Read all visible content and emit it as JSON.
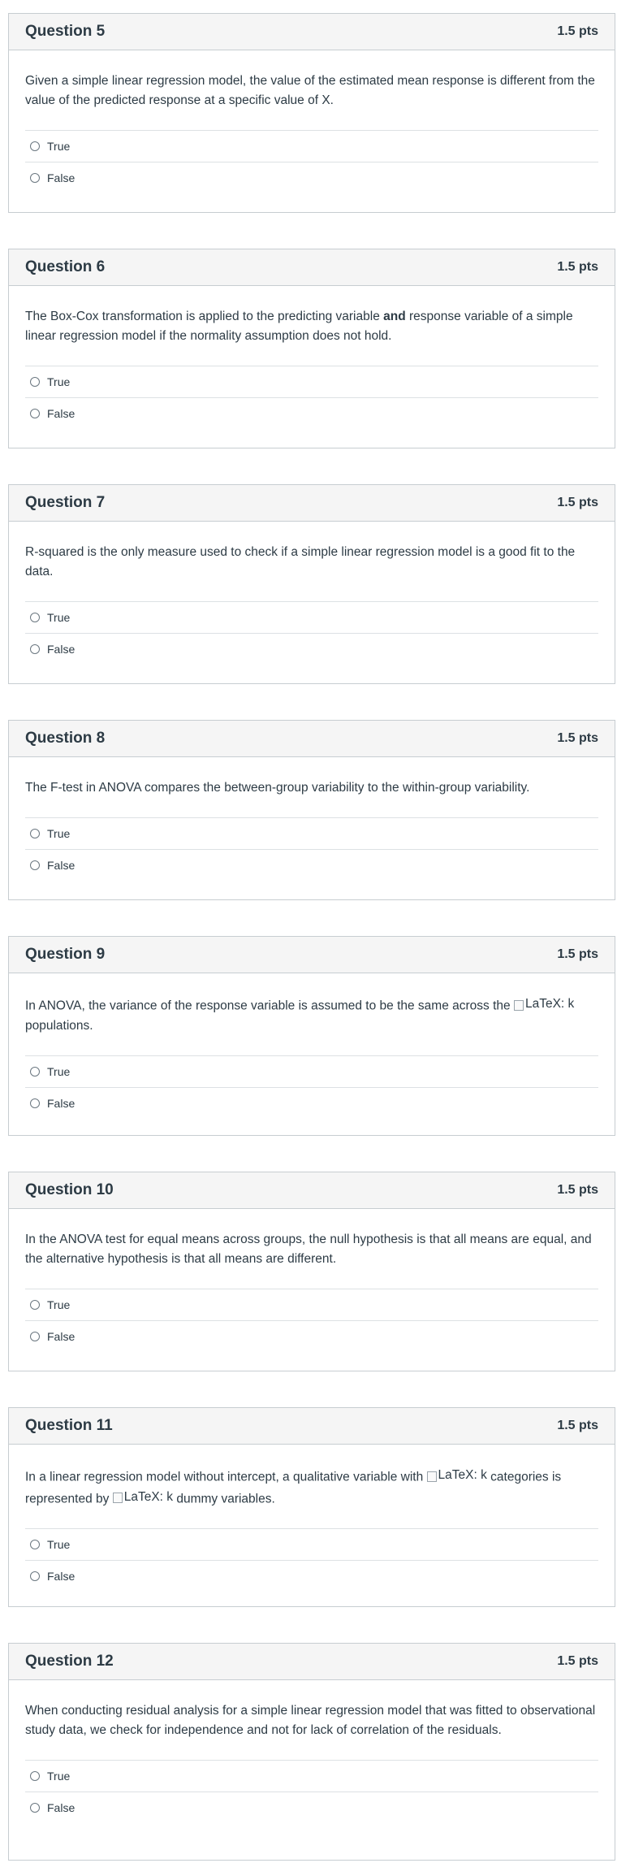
{
  "questions": [
    {
      "title": "Question 5",
      "points": "1.5 pts",
      "text": "Given a simple linear regression model, the value of the estimated mean response is different from the value of the predicted response at a specific value of X.",
      "options": [
        "True",
        "False"
      ]
    },
    {
      "title": "Question 6",
      "points": "1.5 pts",
      "text_before": "The Box-Cox transformation is applied to the predicting variable ",
      "text_bold": "and",
      "text_after": " response variable of a simple linear regression model if the normality assumption does not hold.",
      "options": [
        "True",
        "False"
      ]
    },
    {
      "title": "Question 7",
      "points": "1.5 pts",
      "text": "R-squared is the only measure used to check if a simple linear regression model is a good fit to the data.",
      "options": [
        "True",
        "False"
      ]
    },
    {
      "title": "Question 8",
      "points": "1.5 pts",
      "text": "The F-test in ANOVA compares the between-group variability to the within-group variability.",
      "options": [
        "True",
        "False"
      ]
    },
    {
      "title": "Question 9",
      "points": "1.5 pts",
      "text_before": "In ANOVA, the variance of the response variable is assumed to be the same across the ",
      "latex_1": "LaTeX: k",
      "text_after": " populations.",
      "options": [
        "True",
        "False"
      ]
    },
    {
      "title": "Question 10",
      "points": "1.5 pts",
      "text": "In the ANOVA test for equal means across groups, the null hypothesis is that all means are equal, and the alternative hypothesis is that all means are different.",
      "options": [
        "True",
        "False"
      ]
    },
    {
      "title": "Question 11",
      "points": "1.5 pts",
      "text_before": "In a linear regression model without intercept, a qualitative variable with ",
      "latex_1": "LaTeX: k",
      "text_middle": " categories is represented by ",
      "latex_2": "LaTeX: k",
      "text_after": " dummy variables.",
      "options": [
        "True",
        "False"
      ]
    },
    {
      "title": "Question 12",
      "points": "1.5 pts",
      "text": "When conducting residual analysis for a simple linear regression model that was fitted to observational study data, we check for independence and not for lack of correlation of the residuals.",
      "options": [
        "True",
        "False"
      ]
    }
  ]
}
